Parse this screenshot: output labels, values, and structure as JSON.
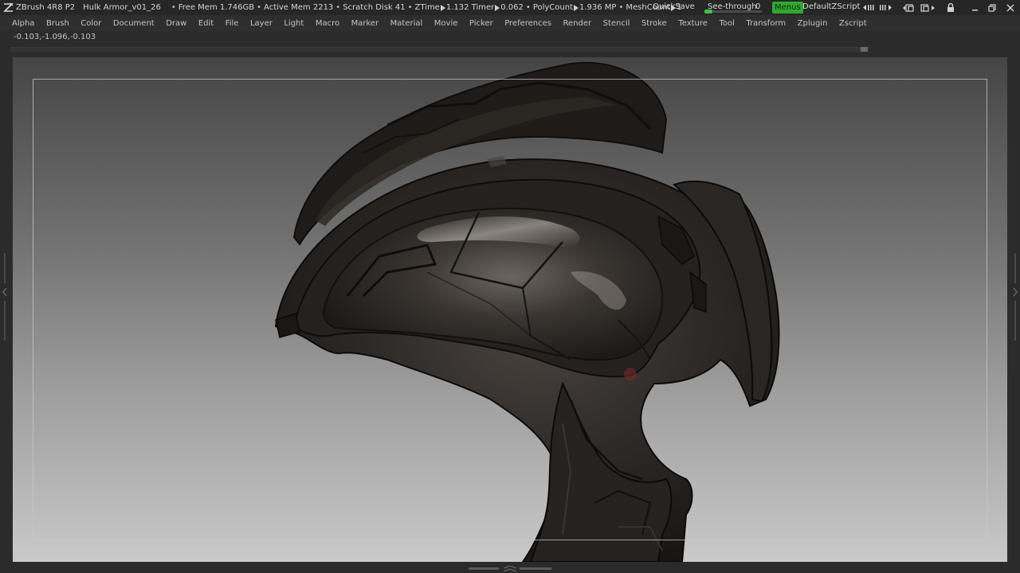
{
  "titlebar": {
    "app_name": "ZBrush 4R8 P2",
    "document_name": "Hulk Armor_v01_26",
    "stats": {
      "free_mem": "Free Mem 1.746GB",
      "active_mem": "Active Mem 2213",
      "scratch_disk": "Scratch Disk 41",
      "ztime_label": "ZTime",
      "ztime_value": "1.132",
      "timer_label": "Timer",
      "timer_value": "0.062",
      "polycount_label": "PolyCount",
      "polycount_value": "1.936 MP",
      "meshcount_label": "MeshCount",
      "meshcount_value": "1"
    },
    "quicksave_label": "QuickSave",
    "seethrough_label": "See-through",
    "seethrough_value": "0",
    "seethrough_level": 0,
    "menus_label": "Menus",
    "zscript_label": "DefaultZScript",
    "accent_color": "#2fa82f"
  },
  "menubar": {
    "items": [
      "Alpha",
      "Brush",
      "Color",
      "Document",
      "Draw",
      "Edit",
      "File",
      "Layer",
      "Light",
      "Macro",
      "Marker",
      "Material",
      "Movie",
      "Picker",
      "Preferences",
      "Render",
      "Stencil",
      "Stroke",
      "Texture",
      "Tool",
      "Transform",
      "Zplugin",
      "Zscript"
    ]
  },
  "coordinates": "-0.103,-1.096,-0.103",
  "icons": [
    "zbrush-logo-icon",
    "arrows-icon",
    "layout-icon",
    "lock-icon",
    "minimize-icon",
    "restore-icon",
    "close-icon"
  ]
}
